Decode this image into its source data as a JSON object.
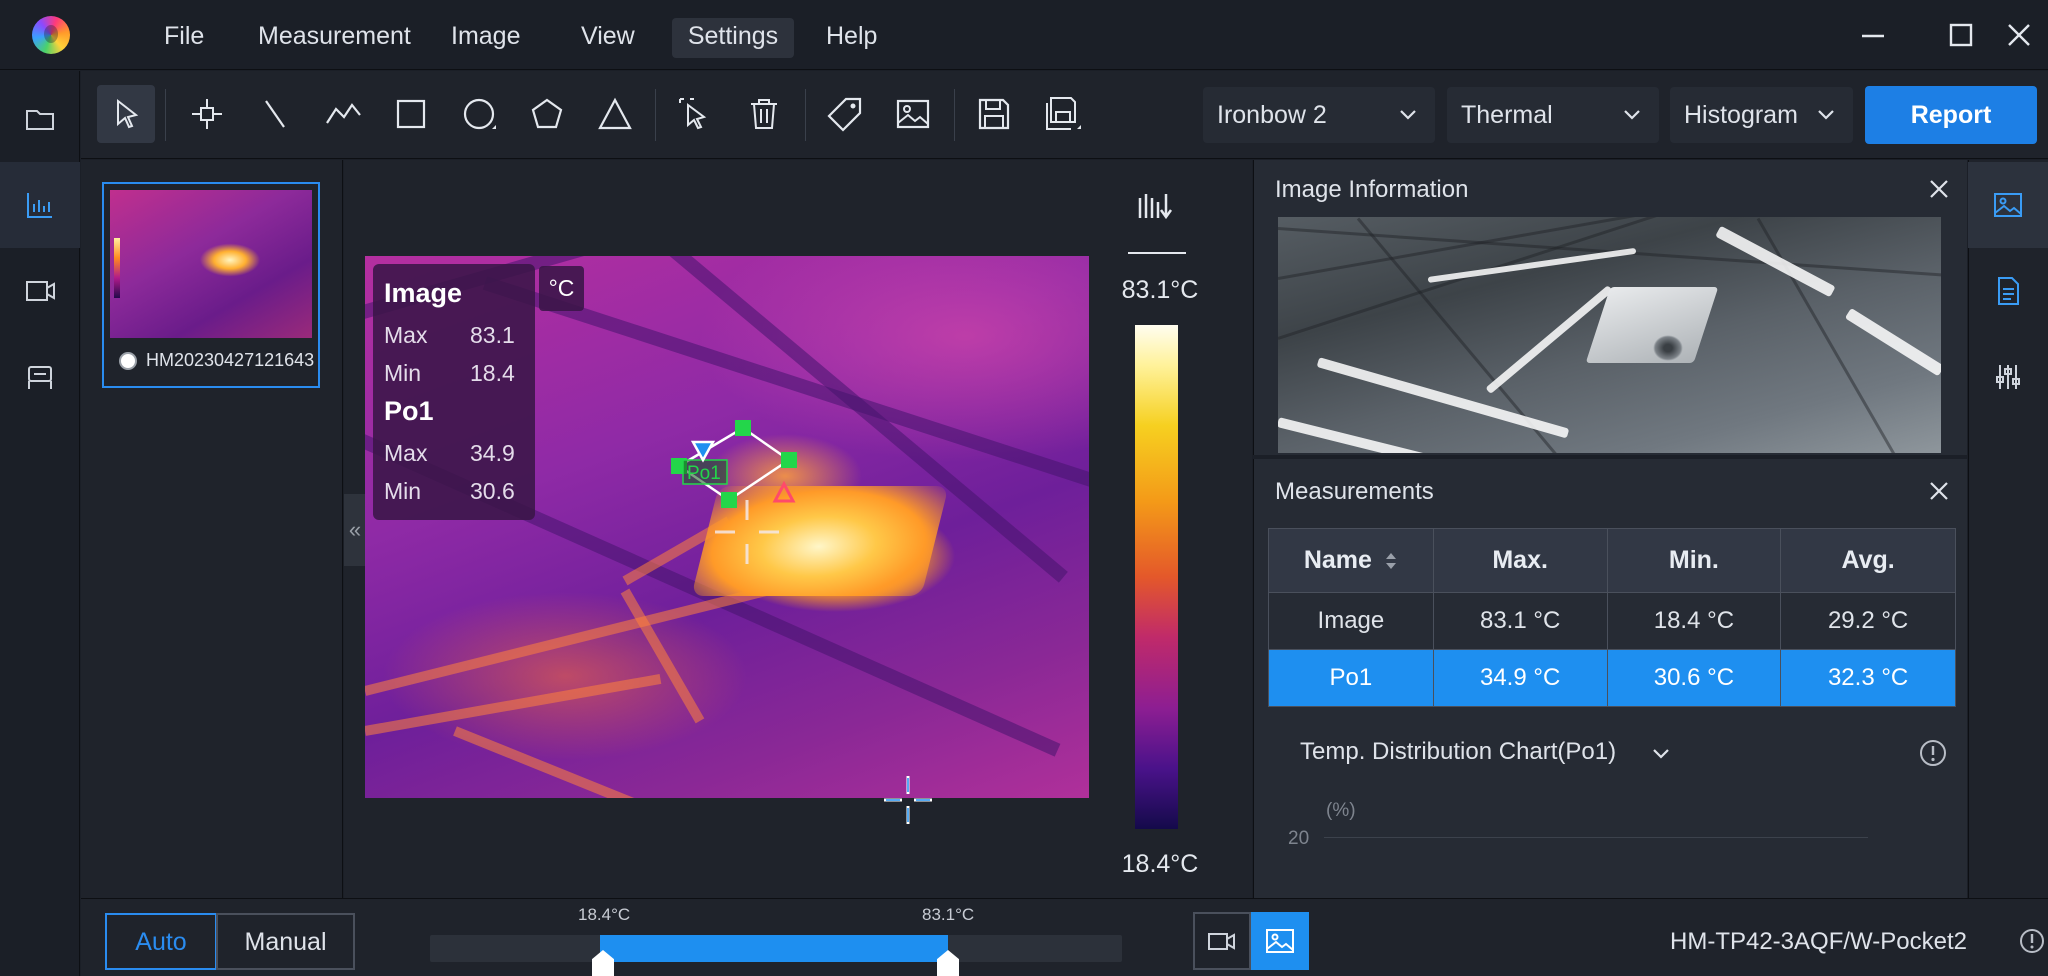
{
  "menu": {
    "items": [
      {
        "label": "File"
      },
      {
        "label": "Measurement"
      },
      {
        "label": "Image"
      },
      {
        "label": "View"
      },
      {
        "label": "Settings",
        "active": true
      },
      {
        "label": "Help"
      }
    ]
  },
  "window_controls": [
    "minimize-icon",
    "maximize-icon",
    "close-icon"
  ],
  "left_rail": [
    "folder-icon",
    "analysis-icon",
    "video-icon",
    "device-icon"
  ],
  "toolbar": {
    "tools": [
      "select-icon",
      "point-icon",
      "line-icon",
      "polyline-icon",
      "rectangle-icon",
      "circle-icon",
      "polygon-icon",
      "triangle-icon",
      "select-region-icon",
      "delete-icon",
      "tag-icon",
      "image-icon",
      "save-icon",
      "save-as-icon"
    ],
    "palette": "Ironbow 2",
    "view_mode": "Thermal",
    "enhance": "Histogram",
    "report_label": "Report"
  },
  "thumbnail": {
    "filename": "HM20230427121643"
  },
  "viewer": {
    "legend": {
      "image_title": "Image",
      "image_max_label": "Max",
      "image_max": "83.1",
      "image_min_label": "Min",
      "image_min": "18.4",
      "roi_title": "Po1",
      "roi_max_label": "Max",
      "roi_max": "34.9",
      "roi_min_label": "Min",
      "roi_min": "30.6"
    },
    "unit": "°C",
    "roi_tag": "Po1",
    "collapse_glyph": "«",
    "scale_max": "83.1°C",
    "scale_min": "18.4°C"
  },
  "image_info": {
    "title": "Image Information"
  },
  "measurements": {
    "title": "Measurements",
    "columns": [
      "Name",
      "Max.",
      "Min.",
      "Avg."
    ],
    "rows": [
      {
        "name": "Image",
        "max": "83.1 °C",
        "min": "18.4 °C",
        "avg": "29.2 °C",
        "selected": false
      },
      {
        "name": "Po1",
        "max": "34.9 °C",
        "min": "30.6 °C",
        "avg": "32.3 °C",
        "selected": true
      }
    ]
  },
  "distribution": {
    "title": "Temp. Distribution Chart(Po1)",
    "y_unit": "(%)",
    "y_tick": "20"
  },
  "right_rail": [
    "image-panel-icon",
    "document-icon",
    "sliders-icon"
  ],
  "bottom": {
    "auto_label": "Auto",
    "manual_label": "Manual",
    "range_low": "18.4°C",
    "range_high": "83.1°C",
    "device": "HM-TP42-3AQF/W-Pocket2"
  },
  "colors": {
    "accent": "#1e8ff0",
    "background": "#1b1f27",
    "panel": "#262b34"
  }
}
